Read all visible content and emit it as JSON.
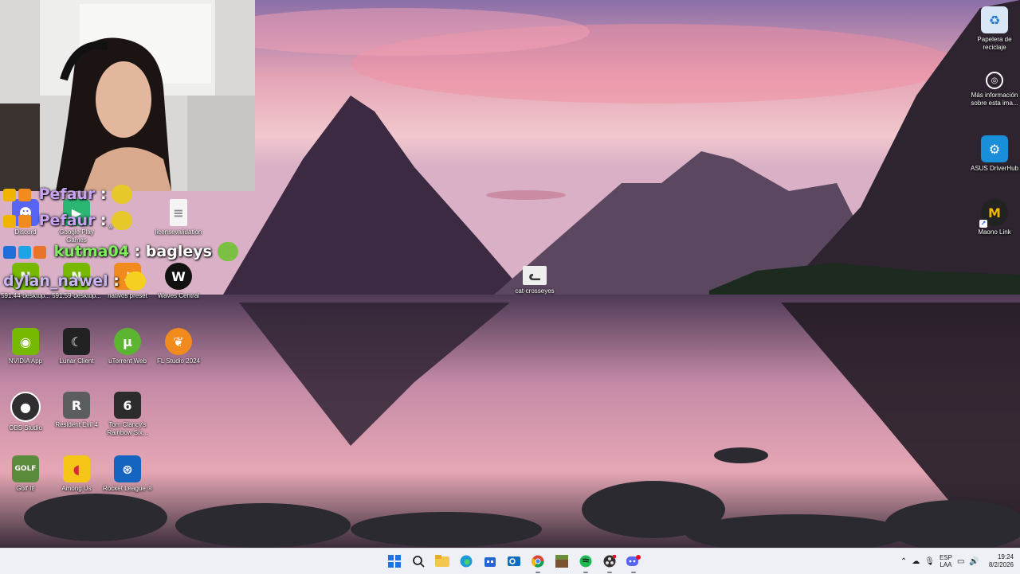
{
  "desktop": {
    "icons": [
      {
        "id": "recycle",
        "label": "Papelera de reciclaje",
        "icon": "recycle-bin-icon",
        "color": "#1e78d6"
      },
      {
        "id": "mas-info",
        "label": "Más información sobre esta ima...",
        "icon": "info-camera-icon",
        "color": "#ffffff"
      },
      {
        "id": "asus",
        "label": "ASUS DriverHub",
        "icon": "asus-gear-icon",
        "color": "#1a8fd9"
      },
      {
        "id": "maono",
        "label": "Maono Link",
        "icon": "maono-icon",
        "color": "#f0b400"
      },
      {
        "id": "discord",
        "label": "Discord",
        "icon": "discord-icon",
        "color": "#5865f2"
      },
      {
        "id": "google-play",
        "label": "Google Play Games",
        "icon": "google-play-icon",
        "color": "#2bb673"
      },
      {
        "id": "w-item",
        "label": "w",
        "icon": "minion-icon",
        "color": "#e7c82a"
      },
      {
        "id": "license",
        "label": "licensevalidation",
        "icon": "text-file-icon",
        "color": "#f4f4f4"
      },
      {
        "id": "nvidia-591-44",
        "label": "591.44-desktop...",
        "icon": "nvidia-installer-icon",
        "color": "#76b900"
      },
      {
        "id": "nvidia-591-59",
        "label": "591.59-desktop...",
        "icon": "nvidia-installer-icon",
        "color": "#76b900"
      },
      {
        "id": "nativos",
        "label": "nativos preset",
        "icon": "fl-preset-icon",
        "color": "#f28b1d"
      },
      {
        "id": "waves",
        "label": "Waves Central",
        "icon": "waves-icon",
        "color": "#111111"
      },
      {
        "id": "cat",
        "label": "cat-crosseyes",
        "icon": "cat-image-icon",
        "color": "#eeeeee"
      },
      {
        "id": "nvidia-app",
        "label": "NVIDIA App",
        "icon": "nvidia-eye-icon",
        "color": "#76b900"
      },
      {
        "id": "lunar",
        "label": "Lunar Client",
        "icon": "lunar-icon",
        "color": "#ffffff"
      },
      {
        "id": "utorrent",
        "label": "uTorrent Web",
        "icon": "utorrent-icon",
        "color": "#5cb531"
      },
      {
        "id": "fl",
        "label": "FL Studio 2024",
        "icon": "fl-studio-icon",
        "color": "#f28b1d"
      },
      {
        "id": "obs",
        "label": "OBS Studio",
        "icon": "obs-icon",
        "color": "#302e31"
      },
      {
        "id": "re4",
        "label": "Resident Evil 4",
        "icon": "re4-icon",
        "color": "#5b5e5e"
      },
      {
        "id": "r6",
        "label": "Tom Clancy's Rainbow Six...",
        "icon": "r6-icon",
        "color": "#2c2c2c"
      },
      {
        "id": "golf",
        "label": "Golf It!",
        "icon": "golf-it-icon",
        "color": "#5a8a3c"
      },
      {
        "id": "amongus",
        "label": "Among Us",
        "icon": "among-us-icon",
        "color": "#d7263d"
      },
      {
        "id": "rocket",
        "label": "Rocket League ®",
        "icon": "rocket-league-icon",
        "color": "#1565c0"
      }
    ]
  },
  "chat": [
    {
      "user": "Pefaur",
      "sep": ":",
      "message": "",
      "user_color": "#c7a3f0"
    },
    {
      "user": "Pefaur",
      "sep": ":",
      "message": "",
      "user_color": "#c7a3f0"
    },
    {
      "user": "kutma04",
      "sep": ":",
      "message": "bagleys",
      "user_color": "#7cf05a"
    },
    {
      "user": "dylan_nawel",
      "sep": ":",
      "message": "",
      "user_color": "#c9b6f3"
    }
  ],
  "taskbar": {
    "apps": [
      {
        "name": "start-button",
        "icon": "windows-icon"
      },
      {
        "name": "search-button",
        "icon": "search-icon"
      },
      {
        "name": "file-explorer-button",
        "icon": "folder-icon"
      },
      {
        "name": "edge-button",
        "icon": "edge-icon"
      },
      {
        "name": "store-button",
        "icon": "store-icon"
      },
      {
        "name": "outlook-button",
        "icon": "outlook-icon"
      },
      {
        "name": "chrome-button",
        "icon": "chrome-icon"
      },
      {
        "name": "minecraft-button",
        "icon": "minecraft-icon"
      },
      {
        "name": "spotify-button",
        "icon": "spotify-icon"
      },
      {
        "name": "obs-button",
        "icon": "obs-icon"
      },
      {
        "name": "discord-button",
        "icon": "discord-icon"
      }
    ],
    "tray": {
      "lang_top": "ESP",
      "lang_bottom": "LAA",
      "time": "19:24",
      "date": "8/2/2026"
    }
  }
}
